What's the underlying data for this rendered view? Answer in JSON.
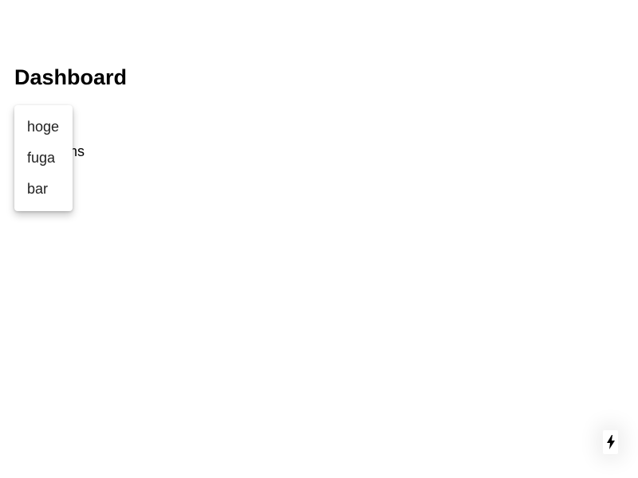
{
  "header": {
    "title": "Dashboard"
  },
  "content": {
    "partial_text": "ms"
  },
  "menu": {
    "items": [
      {
        "label": "hoge"
      },
      {
        "label": "fuga"
      },
      {
        "label": "bar"
      }
    ]
  },
  "fab": {
    "icon": "lightning-icon",
    "icon_color": "#000000"
  }
}
